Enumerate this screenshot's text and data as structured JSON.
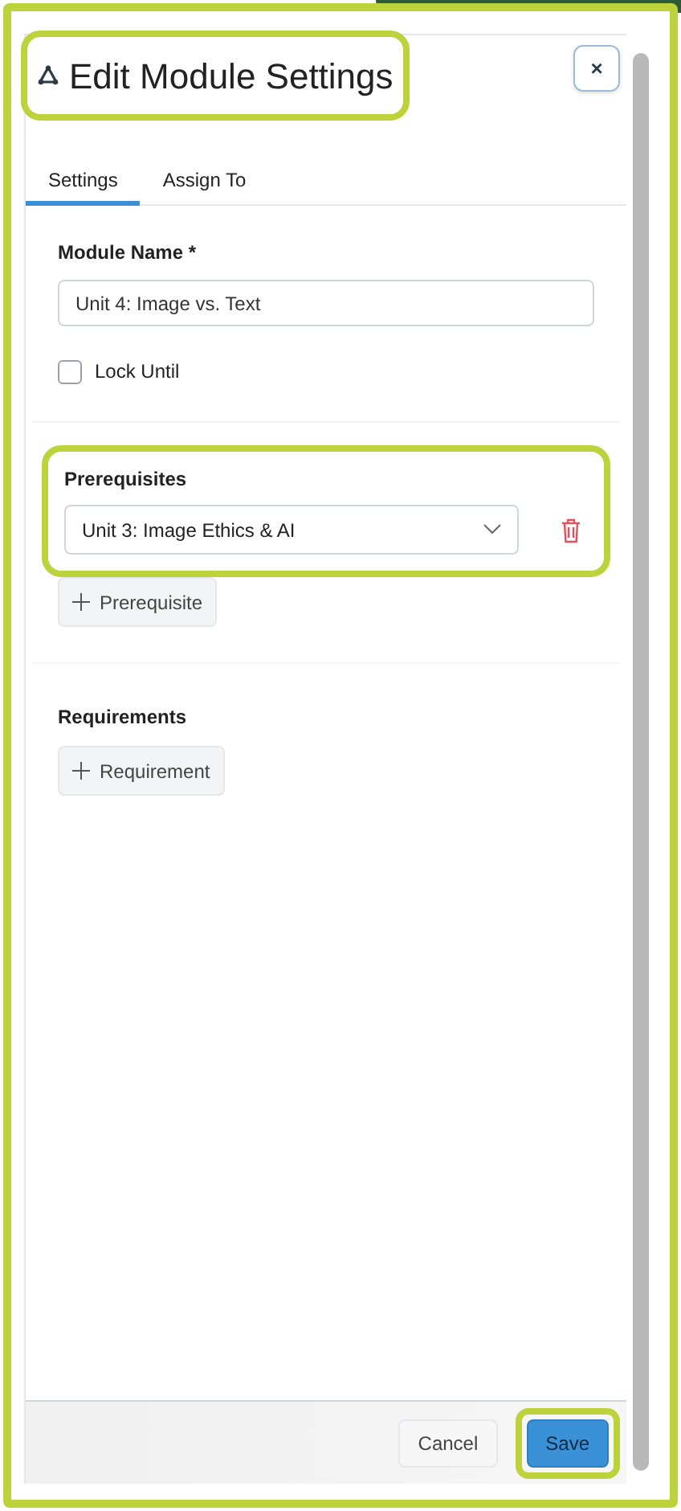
{
  "dialog": {
    "title": "Edit Module Settings",
    "title_highlighted": true,
    "close_label": "×",
    "tabs": [
      {
        "label": "Settings",
        "selected": true
      },
      {
        "label": "Assign To",
        "selected": false
      }
    ],
    "module_name": {
      "label": "Module Name *",
      "value": "Unit 4: Image vs. Text"
    },
    "lock_until": {
      "label": "Lock Until",
      "checked": false
    },
    "prerequisites": {
      "label": "Prerequisites",
      "highlighted": true,
      "items": [
        {
          "value": "Unit 3: Image Ethics & AI"
        }
      ],
      "add_button": "Prerequisite"
    },
    "requirements": {
      "label": "Requirements",
      "add_button": "Requirement"
    },
    "footer": {
      "buttons": [
        {
          "label": "Cancel",
          "kind": "secondary",
          "highlighted": false
        },
        {
          "label": "Save",
          "kind": "primary",
          "highlighted": true
        }
      ]
    }
  }
}
